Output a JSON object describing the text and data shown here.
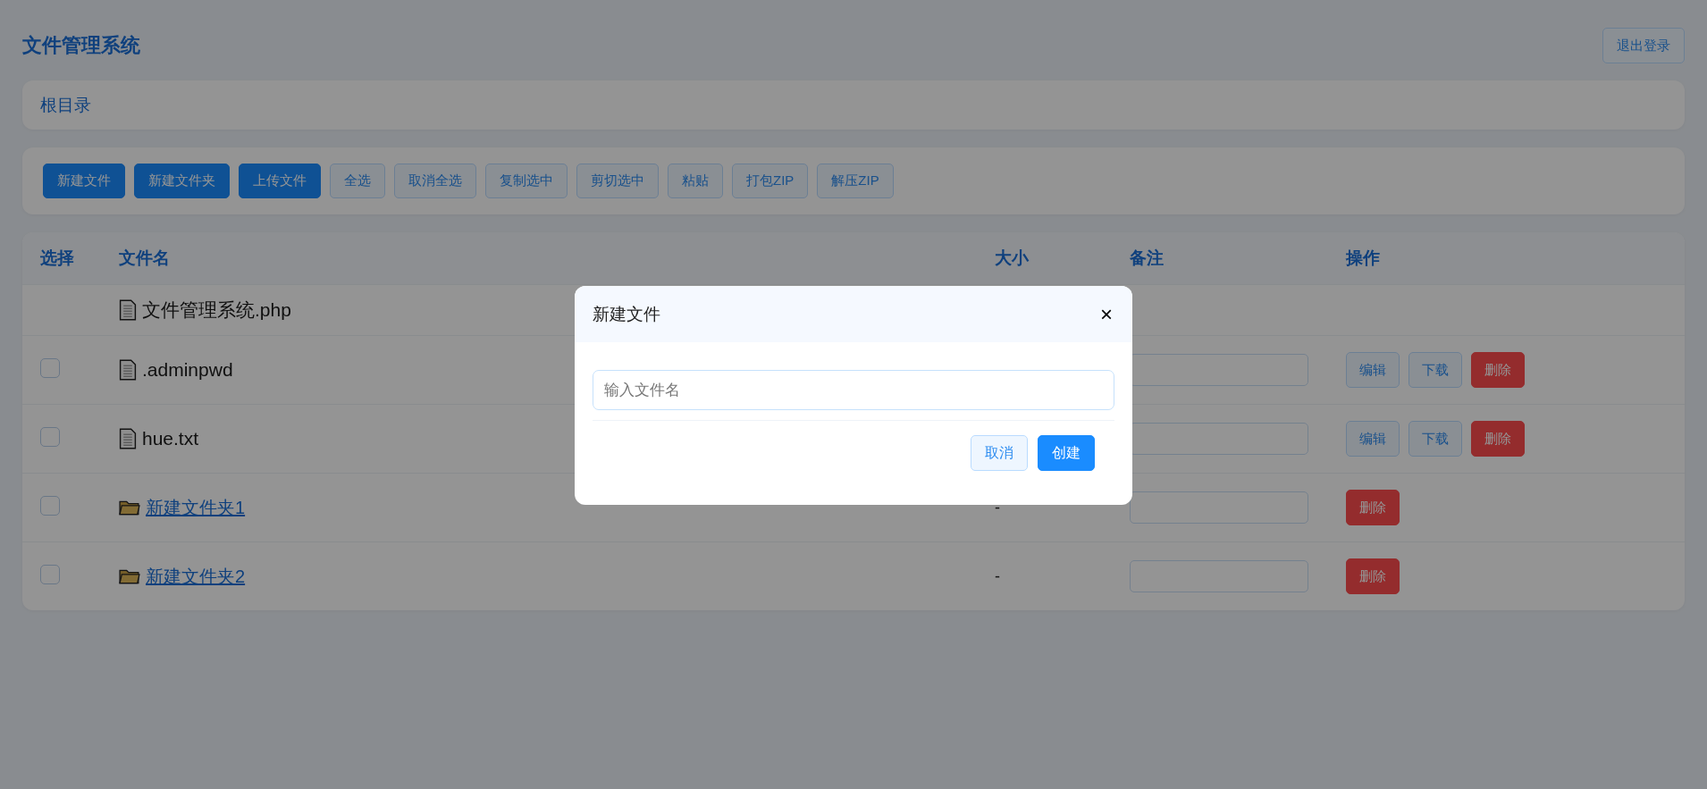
{
  "header": {
    "title": "文件管理系统",
    "logout": "退出登录"
  },
  "breadcrumb": "根目录",
  "toolbar": [
    {
      "label": "新建文件",
      "kind": "primary"
    },
    {
      "label": "新建文件夹",
      "kind": "primary"
    },
    {
      "label": "上传文件",
      "kind": "primary"
    },
    {
      "label": "全选",
      "kind": "plain"
    },
    {
      "label": "取消全选",
      "kind": "plain"
    },
    {
      "label": "复制选中",
      "kind": "plain"
    },
    {
      "label": "剪切选中",
      "kind": "plain"
    },
    {
      "label": "粘贴",
      "kind": "plain"
    },
    {
      "label": "打包ZIP",
      "kind": "plain"
    },
    {
      "label": "解压ZIP",
      "kind": "plain"
    }
  ],
  "table": {
    "columns": [
      "选择",
      "文件名",
      "大小",
      "备注",
      "操作"
    ],
    "rows": [
      {
        "kind": "file",
        "name": "文件管理系统.php",
        "actions": []
      },
      {
        "kind": "file",
        "name": ".adminpwd",
        "checked": false,
        "note_field": true,
        "actions": [
          {
            "label": "编辑",
            "kind": "plain"
          },
          {
            "label": "下载",
            "kind": "plain"
          },
          {
            "label": "删除",
            "kind": "danger"
          }
        ]
      },
      {
        "kind": "file",
        "name": "hue.txt",
        "checked": false,
        "note_field": true,
        "actions": [
          {
            "label": "编辑",
            "kind": "plain"
          },
          {
            "label": "下载",
            "kind": "plain"
          },
          {
            "label": "删除",
            "kind": "danger"
          }
        ]
      },
      {
        "kind": "folder",
        "name": "新建文件夹1",
        "checked": false,
        "size": "-",
        "note_field": true,
        "actions": [
          {
            "label": "删除",
            "kind": "danger"
          }
        ]
      },
      {
        "kind": "folder",
        "name": "新建文件夹2",
        "checked": false,
        "size": "-",
        "note_field": true,
        "actions": [
          {
            "label": "删除",
            "kind": "danger"
          }
        ]
      }
    ]
  },
  "dialog": {
    "title": "新建文件",
    "close": "×",
    "placeholder": "输入文件名",
    "buttons": [
      {
        "label": "取消",
        "kind": "plain"
      },
      {
        "label": "创建",
        "kind": "primary"
      }
    ]
  }
}
